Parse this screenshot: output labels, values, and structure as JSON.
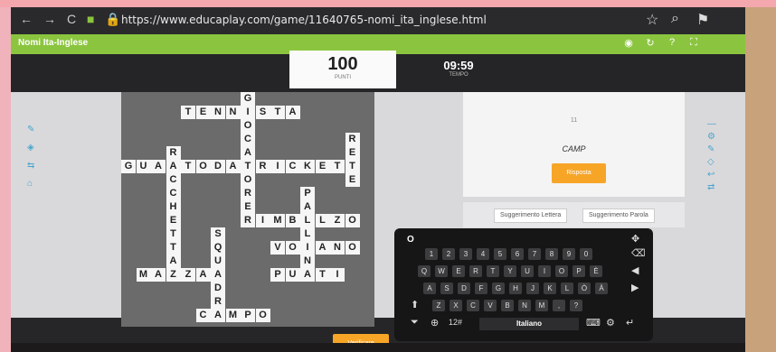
{
  "browser": {
    "url": "https://www.educaplay.com/game/11640765-nomi_ita_inglese.html"
  },
  "app": {
    "title": "Nomi Ita-Inglese"
  },
  "hud": {
    "score": "100",
    "score_label": "PUNTI",
    "time": "09:59",
    "time_label": "TEMPO"
  },
  "clue": {
    "number": "11",
    "word": "CAMP",
    "answer_button": "Risposta",
    "hint_letter": "Suggerimento Lettera",
    "hint_word": "Suggerimento Parola"
  },
  "crossword": {
    "words": [
      {
        "text": "TENNISTA"
      },
      {
        "text": "GIOCATORE"
      },
      {
        "text": "RETE"
      },
      {
        "text": "RACCHETTA"
      },
      {
        "text": "GUANTODACRICKET"
      },
      {
        "text": "PALLINA"
      },
      {
        "text": "RIMBALZO"
      },
      {
        "text": "SQUADRA"
      },
      {
        "text": "VOLANO"
      },
      {
        "text": "MAZZA"
      },
      {
        "text": "PUNTI"
      },
      {
        "text": "CAMPO"
      }
    ]
  },
  "keyboard": {
    "top_label": "O",
    "num_row": [
      "1",
      "2",
      "3",
      "4",
      "5",
      "6",
      "7",
      "8",
      "9",
      "0"
    ],
    "row1": [
      "Q",
      "W",
      "E",
      "R",
      "T",
      "Y",
      "U",
      "I",
      "O",
      "P",
      "È"
    ],
    "row2": [
      "A",
      "S",
      "D",
      "F",
      "G",
      "H",
      "J",
      "K",
      "L",
      "Ò",
      "À"
    ],
    "row3": [
      "Z",
      "X",
      "C",
      "V",
      "B",
      "N",
      "M",
      ",",
      "?"
    ],
    "numbers_label": "12#",
    "language": "Italiano"
  },
  "verify_button": "Verificare"
}
